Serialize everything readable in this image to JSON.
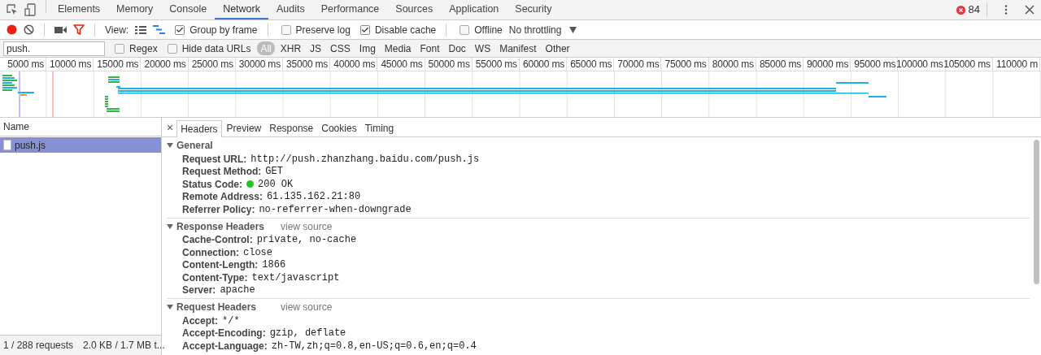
{
  "top_tabs": [
    {
      "label": "Elements",
      "selected": false
    },
    {
      "label": "Memory",
      "selected": false
    },
    {
      "label": "Console",
      "selected": false
    },
    {
      "label": "Network",
      "selected": true
    },
    {
      "label": "Audits",
      "selected": false
    },
    {
      "label": "Performance",
      "selected": false
    },
    {
      "label": "Sources",
      "selected": false
    },
    {
      "label": "Application",
      "selected": false
    },
    {
      "label": "Security",
      "selected": false
    }
  ],
  "error_count": "84",
  "toolbar": {
    "recording": true,
    "view_label": "View:",
    "large_rows": false,
    "show_overview": true,
    "checkboxes": [
      {
        "label": "Group by frame",
        "checked": true
      },
      {
        "label": "Preserve log",
        "checked": false
      },
      {
        "label": "Disable cache",
        "checked": true
      },
      {
        "label": "Offline",
        "checked": false
      }
    ],
    "throttling": "No throttling"
  },
  "filter": {
    "value": "push.",
    "checkboxes": [
      {
        "label": "Regex",
        "checked": false
      },
      {
        "label": "Hide data URLs",
        "checked": false
      }
    ],
    "types": [
      {
        "label": "All",
        "selected": true
      },
      {
        "label": "XHR",
        "selected": false
      },
      {
        "label": "JS",
        "selected": false
      },
      {
        "label": "CSS",
        "selected": false
      },
      {
        "label": "Img",
        "selected": false
      },
      {
        "label": "Media",
        "selected": false
      },
      {
        "label": "Font",
        "selected": false
      },
      {
        "label": "Doc",
        "selected": false
      },
      {
        "label": "WS",
        "selected": false
      },
      {
        "label": "Manifest",
        "selected": false
      },
      {
        "label": "Other",
        "selected": false
      }
    ]
  },
  "overview": {
    "ticks": [
      "5000 ms",
      "10000 ms",
      "15000 ms",
      "20000 ms",
      "25000 ms",
      "30000 ms",
      "35000 ms",
      "40000 ms",
      "45000 ms",
      "50000 ms",
      "55000 ms",
      "60000 ms",
      "65000 ms",
      "70000 ms",
      "75000 ms",
      "80000 ms",
      "85000 ms",
      "90000 ms",
      "95000 ms",
      "100000 ms",
      "105000 ms",
      "110000 m"
    ]
  },
  "requests": {
    "column": "Name",
    "rows": [
      {
        "name": "push.js",
        "selected": true
      }
    ],
    "summary": [
      "1 / 288 requests",
      "2.0 KB / 1.7 MB t..."
    ]
  },
  "details": {
    "close": "×",
    "tabs": [
      {
        "label": "Headers",
        "selected": true
      },
      {
        "label": "Preview",
        "selected": false
      },
      {
        "label": "Response",
        "selected": false
      },
      {
        "label": "Cookies",
        "selected": false
      },
      {
        "label": "Timing",
        "selected": false
      }
    ],
    "sections": [
      {
        "title": "General",
        "expanded": true,
        "rows": [
          {
            "key": "Request URL:",
            "value": "http://push.zhanzhang.baidu.com/push.js"
          },
          {
            "key": "Request Method:",
            "value": "GET"
          },
          {
            "key": "Status Code:",
            "value": "200 OK",
            "color": "#22c322"
          },
          {
            "key": "Remote Address:",
            "value": "61.135.162.21:80"
          },
          {
            "key": "Referrer Policy:",
            "value": "no-referrer-when-downgrade"
          }
        ]
      },
      {
        "title": "Response Headers",
        "expanded": true,
        "link": "view source",
        "rows": [
          {
            "key": "Cache-Control:",
            "value": "private, no-cache"
          },
          {
            "key": "Connection:",
            "value": "close"
          },
          {
            "key": "Content-Length:",
            "value": "1866"
          },
          {
            "key": "Content-Type:",
            "value": "text/javascript"
          },
          {
            "key": "Server:",
            "value": "apache"
          }
        ]
      },
      {
        "title": "Request Headers",
        "expanded": true,
        "link": "view source",
        "rows": [
          {
            "key": "Accept:",
            "value": "*/*"
          },
          {
            "key": "Accept-Encoding:",
            "value": "gzip, deflate"
          },
          {
            "key": "Accept-Language:",
            "value": "zh-TW,zh;q=0.8,en-US;q=0.6,en;q=0.4"
          }
        ]
      }
    ]
  }
}
